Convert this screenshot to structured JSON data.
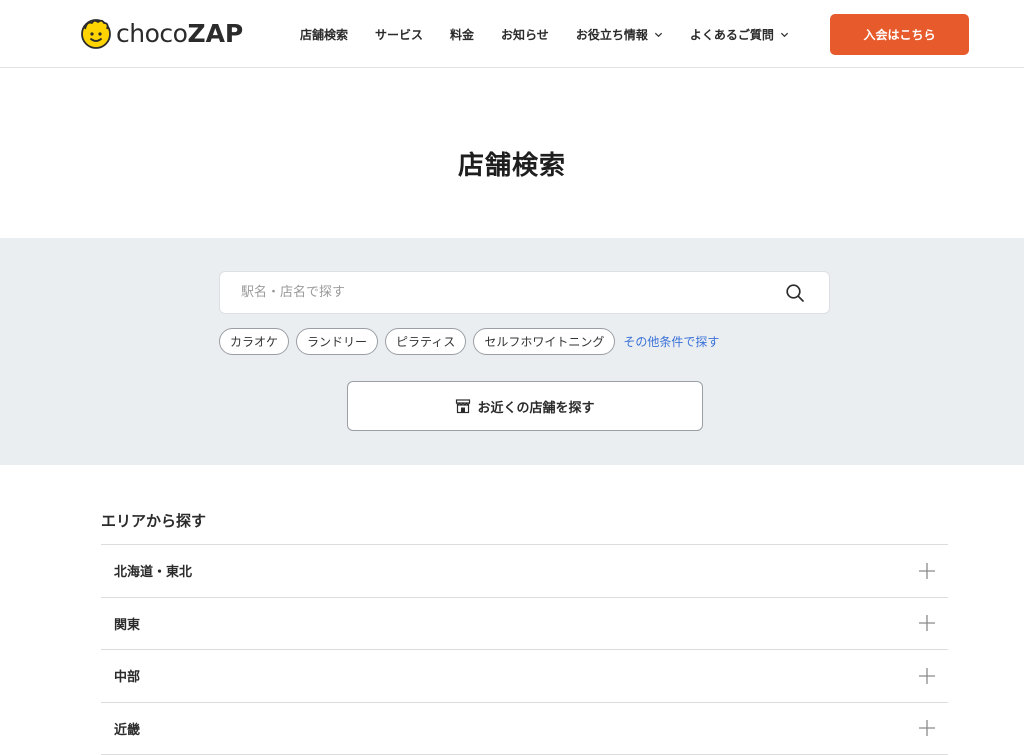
{
  "header": {
    "logo": {
      "text_choco": "choco",
      "text_zap": "ZAP"
    },
    "nav": [
      {
        "label": "店舗検索",
        "has_dropdown": false
      },
      {
        "label": "サービス",
        "has_dropdown": false
      },
      {
        "label": "料金",
        "has_dropdown": false
      },
      {
        "label": "お知らせ",
        "has_dropdown": false
      },
      {
        "label": "お役立ち情報",
        "has_dropdown": true
      },
      {
        "label": "よくあるご質問",
        "has_dropdown": true
      }
    ],
    "cta_label": "入会はこちら",
    "cta_color": "#e75a2c"
  },
  "page": {
    "title": "店舗検索"
  },
  "search": {
    "placeholder": "駅名・店名で探す",
    "value": "",
    "icon": "search-icon",
    "tags": [
      "カラオケ",
      "ランドリー",
      "ピラティス",
      "セルフホワイトニング"
    ],
    "more_link": "その他条件で探す",
    "nearby_label": "お近くの店舗を探す",
    "nearby_icon": "shop-icon"
  },
  "area": {
    "heading": "エリアから探す",
    "items": [
      {
        "label": "北海道・東北"
      },
      {
        "label": "関東"
      },
      {
        "label": "中部"
      },
      {
        "label": "近畿"
      }
    ],
    "expand_icon": "plus-icon"
  }
}
